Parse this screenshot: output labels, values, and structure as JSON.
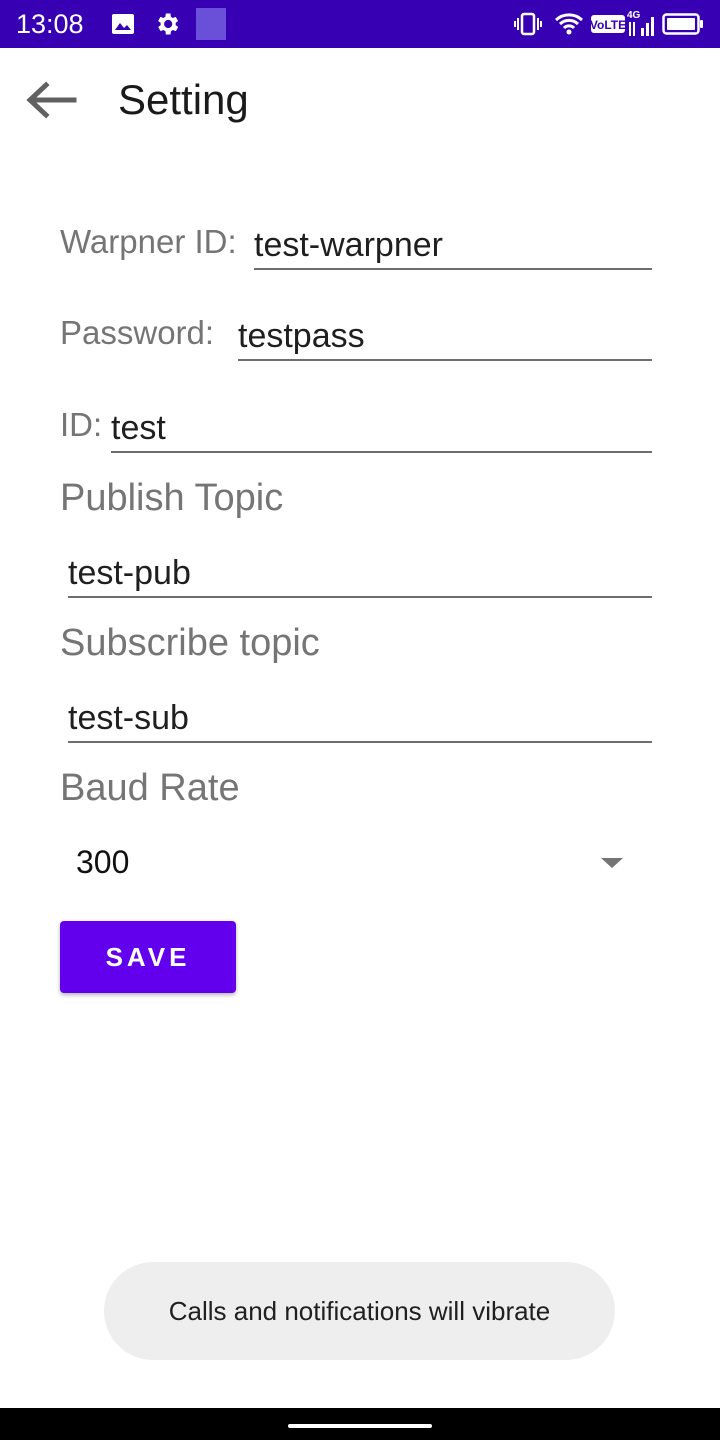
{
  "status_bar": {
    "time": "13:08",
    "icons": [
      "image-icon",
      "gear-icon",
      "app-square-icon",
      "vibrate-icon",
      "wifi-icon",
      "volte-icon",
      "signal-4g-icon",
      "battery-icon"
    ]
  },
  "toolbar": {
    "title": "Setting"
  },
  "form": {
    "warpner_id": {
      "label": "Warpner ID:",
      "value": "test-warpner"
    },
    "password": {
      "label": "Password:",
      "value": "testpass"
    },
    "id": {
      "label": "ID:",
      "value": "test"
    },
    "publish_topic": {
      "label": "Publish Topic",
      "value": "test-pub"
    },
    "subscribe_topic": {
      "label": "Subscribe topic",
      "value": "test-sub"
    },
    "baud_rate": {
      "label": "Baud Rate",
      "selected": "300"
    }
  },
  "save_label": "SAVE",
  "toast": "Calls and notifications will vibrate",
  "colors": {
    "status_bar": "#3700b3",
    "accent": "#6200ee",
    "label": "#757575"
  }
}
